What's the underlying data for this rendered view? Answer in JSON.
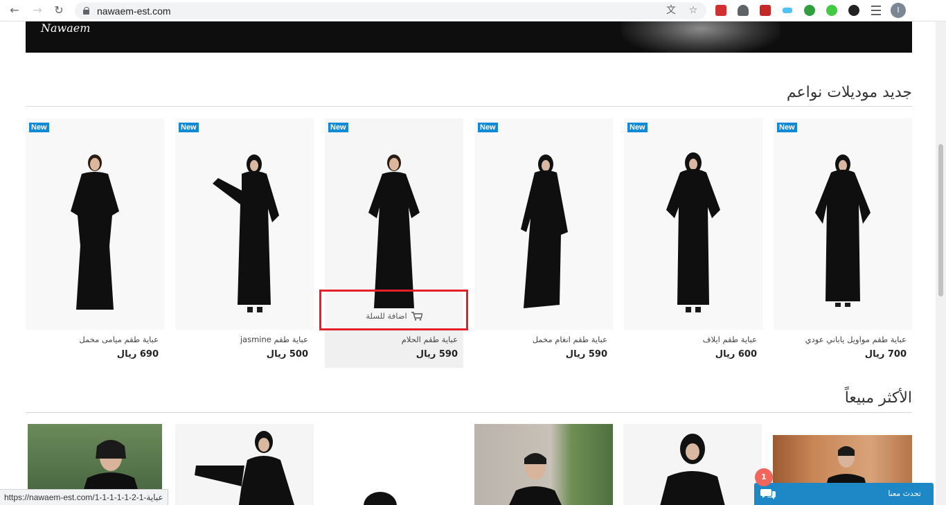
{
  "browser": {
    "url": "nawaem-est.com",
    "profile_initial": "I"
  },
  "banner": {
    "logo_text": "Nawaem"
  },
  "new_section": {
    "title": "جديد موديلات نواعم",
    "badge": "New",
    "add_to_cart_label": "اضافة للسلة",
    "products": [
      {
        "name": "عباية طقم مواويل ياباني عودي",
        "price": "700 ريال"
      },
      {
        "name": "عباية طقم ايلاف",
        "price": "600 ريال"
      },
      {
        "name": "عباية طقم انغام مخمل",
        "price": "590 ريال"
      },
      {
        "name": "عباية طقم الحلام",
        "price": "590 ريال"
      },
      {
        "name": "عباية طقم jasmine",
        "price": "500 ريال"
      },
      {
        "name": "عباية طقم ميامى مخمل",
        "price": "690 ريال"
      }
    ]
  },
  "best_section": {
    "title": "الأكثر مبيعاً"
  },
  "status_bar": {
    "hover_url": "https://nawaem-est.com/1-1-1-1-1-2-1-عباية"
  },
  "chat": {
    "label": "تحدث معنا",
    "unread_count": "1"
  },
  "colors": {
    "badge": "#1089d6",
    "highlight": "#e5202b",
    "chat": "#1e87c6",
    "chat_badge": "#f0665b"
  }
}
